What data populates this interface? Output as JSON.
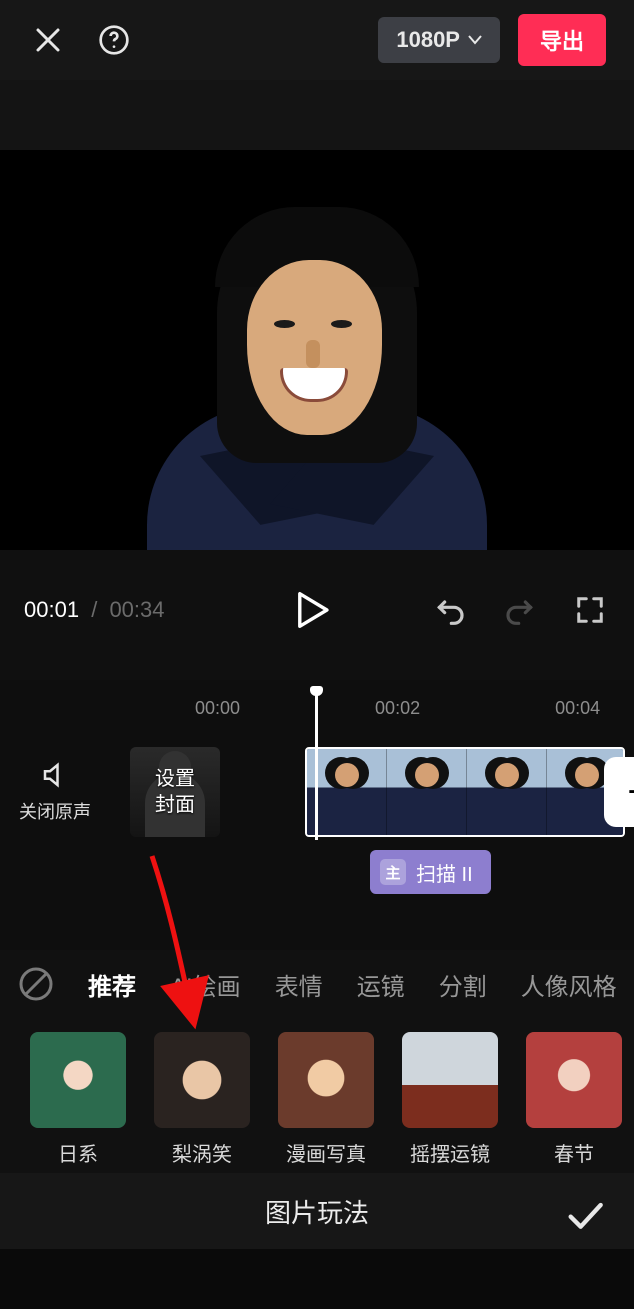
{
  "topbar": {
    "resolution_label": "1080P",
    "export_label": "导出"
  },
  "player": {
    "current_time": "00:01",
    "separator": "/",
    "duration": "00:34"
  },
  "ruler": {
    "ticks": [
      "00:00",
      "00:02",
      "00:04"
    ]
  },
  "timeline": {
    "mute_label": "关闭原声",
    "cover_label_line1": "设置",
    "cover_label_line2": "封面",
    "add_label": "+",
    "effect_glyph": "主",
    "effect_label": "扫描 II"
  },
  "categories": {
    "tabs": [
      "推荐",
      "AI绘画",
      "表情",
      "运镜",
      "分割",
      "人像风格"
    ],
    "active_index": 0
  },
  "effects": {
    "items": [
      {
        "label": "日系"
      },
      {
        "label": "梨涡笑"
      },
      {
        "label": "漫画写真"
      },
      {
        "label": "摇摆运镜"
      },
      {
        "label": "春节"
      }
    ]
  },
  "bottom": {
    "title": "图片玩法"
  }
}
